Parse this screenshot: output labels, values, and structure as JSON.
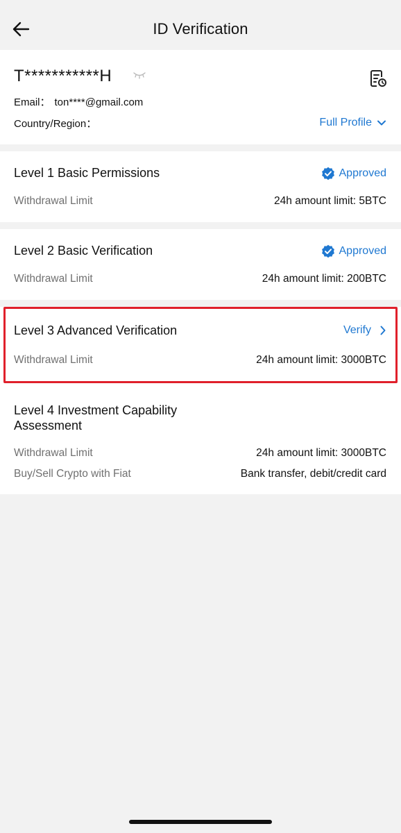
{
  "header": {
    "title": "ID Verification"
  },
  "profile": {
    "masked_name": "T***********H",
    "email_label": "Email：",
    "email_value": "ton****@gmail.com",
    "country_label": "Country/Region：",
    "full_profile_label": "Full Profile"
  },
  "levels": [
    {
      "title": "Level 1 Basic Permissions",
      "status": "Approved",
      "rows": [
        {
          "label": "Withdrawal Limit",
          "value": "24h amount limit: 5BTC"
        }
      ]
    },
    {
      "title": "Level 2 Basic Verification",
      "status": "Approved",
      "rows": [
        {
          "label": "Withdrawal Limit",
          "value": "24h amount limit: 200BTC"
        }
      ]
    },
    {
      "title": "Level 3 Advanced Verification",
      "status": "Verify",
      "rows": [
        {
          "label": "Withdrawal Limit",
          "value": "24h amount limit: 3000BTC"
        }
      ]
    },
    {
      "title_line1": "Level 4 Investment Capability",
      "title_line2": "Assessment",
      "rows": [
        {
          "label": "Withdrawal Limit",
          "value": "24h amount limit: 3000BTC"
        },
        {
          "label": "Buy/Sell Crypto with Fiat",
          "value": "Bank transfer, debit/credit card"
        }
      ]
    }
  ],
  "colors": {
    "accent": "#1f78d1",
    "highlight": "#e0202b",
    "muted_text": "#707070"
  }
}
